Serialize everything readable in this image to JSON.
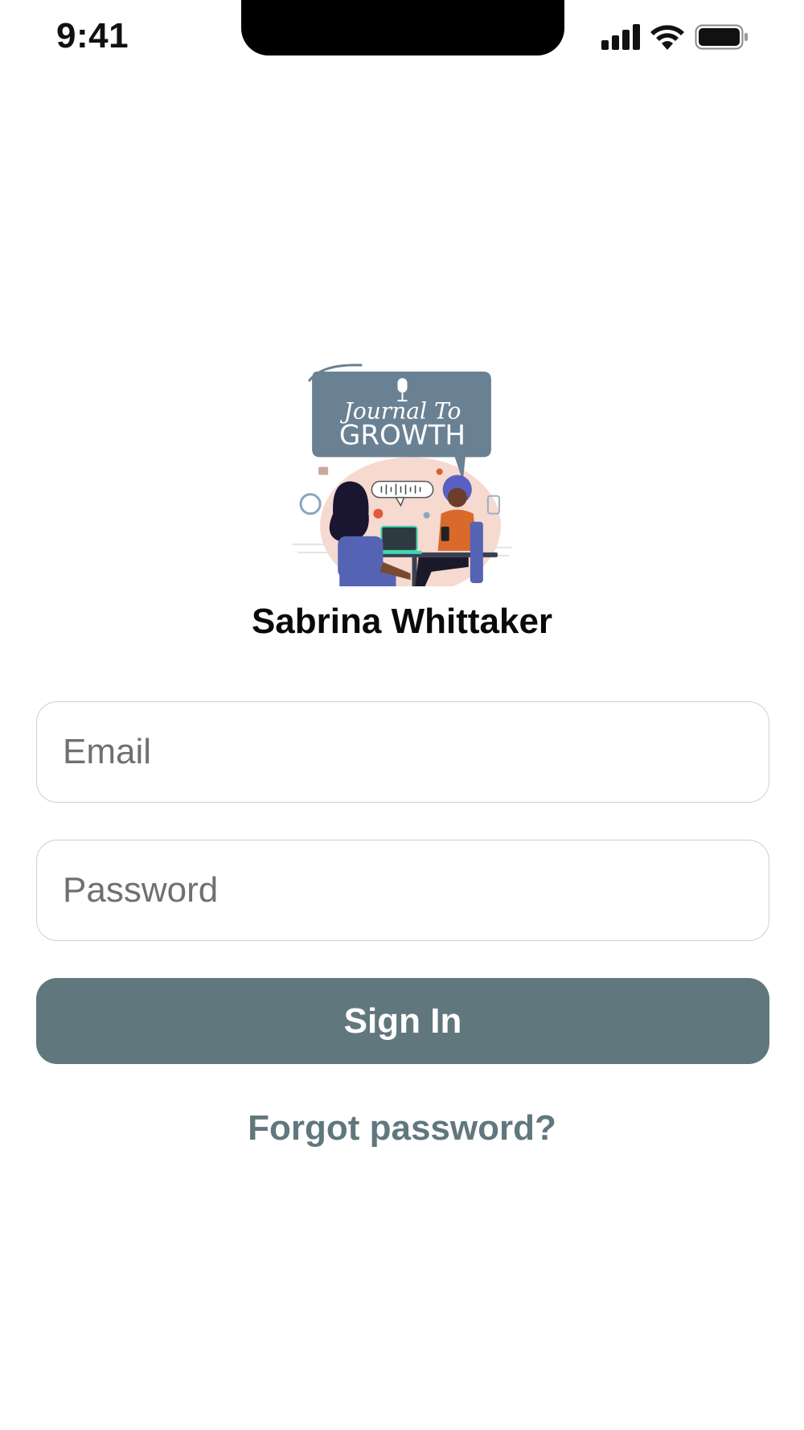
{
  "status_bar": {
    "time": "9:41"
  },
  "logo": {
    "line1": "Journal To",
    "line2": "GROWTH"
  },
  "app_name": "Sabrina Whittaker",
  "form": {
    "email_placeholder": "Email",
    "email_value": "",
    "password_placeholder": "Password",
    "password_value": "",
    "sign_in_label": "Sign In",
    "forgot_label": "Forgot password?"
  },
  "colors": {
    "accent": "#61777e",
    "logo_bubble": "#6a8193",
    "logo_blob": "#f6d9cf"
  },
  "icons": [
    "cellular-signal-icon",
    "wifi-icon",
    "battery-icon",
    "microphone-icon"
  ]
}
